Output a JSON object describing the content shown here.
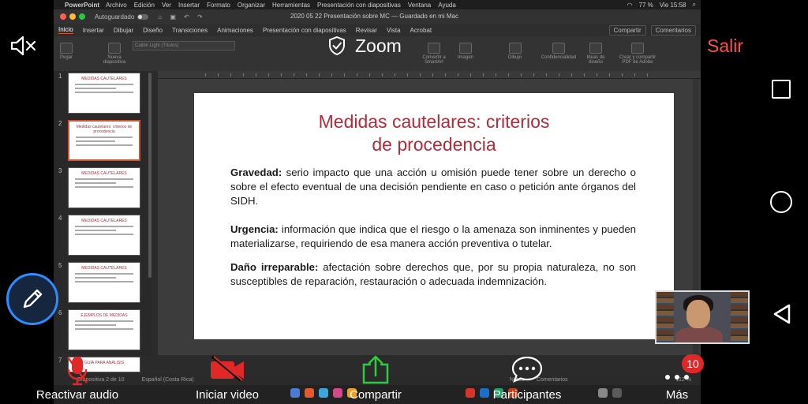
{
  "mac_menu": {
    "app": "PowerPoint",
    "items": [
      "Archivo",
      "Edición",
      "Ver",
      "Insertar",
      "Formato",
      "Organizar",
      "Herramientas",
      "Presentación con diapositivas",
      "Ventana",
      "Ayuda"
    ],
    "battery": "77 %",
    "clock": "Vie 15:58"
  },
  "ppt": {
    "autosave_label": "Autoguardado",
    "doc_title": "2020 05 22 Presentación sobre MC — Guardado en mi Mac",
    "tabs": [
      "Inicio",
      "Insertar",
      "Dibujar",
      "Diseño",
      "Transiciones",
      "Animaciones",
      "Presentación con diapositivas",
      "Revisar",
      "Vista",
      "Acrobat"
    ],
    "share_label": "Compartir",
    "comments_label": "Comentarios",
    "ribbon": {
      "paste": "Pegar",
      "new_slide": "Nueva diapositiva",
      "font": "Calibri Light (Títulos)",
      "smartart": "Convertir a SmartArt",
      "image": "Imagen",
      "draw": "Dibujo",
      "confidentiality": "Confidencialidad",
      "design_ideas": "Ideas de diseño",
      "create_pdf": "Crear y compartir PDF de Adobe"
    },
    "thumbnails": [
      {
        "num": "1",
        "title": "MEDIDAS CAUTELARES"
      },
      {
        "num": "2",
        "title": "Medidas cautelares: criterios de procedencia"
      },
      {
        "num": "3",
        "title": "MEDIDAS CAUTELARES"
      },
      {
        "num": "4",
        "title": "MEDIDAS CAUTELARES"
      },
      {
        "num": "5",
        "title": "MEDIDAS CAUTELARES"
      },
      {
        "num": "6",
        "title": "EJEMPLOS DE MEDIDAS"
      },
      {
        "num": "7",
        "title": "GUÍA PARA ANÁLISIS"
      }
    ],
    "status": {
      "slide_of": "Diapositiva 2 de 10",
      "language": "Español (Costa Rica)",
      "notes": "Notas",
      "comments": "Comentarios",
      "zoom": "112 %"
    }
  },
  "slide": {
    "title_line1": "Medidas cautelares: criterios",
    "title_line2": "de procedencia",
    "paragraphs": [
      {
        "term": "Gravedad:",
        "text": " serio impacto que una acción u omisión puede tener sobre un derecho o sobre el efecto eventual de una decisión pendiente en caso o petición ante órganos del SIDH."
      },
      {
        "term": "Urgencia:",
        "text": " información que indica que el riesgo o la amenaza son inminentes y pueden materializarse, requiriendo de esa manera acción preventiva o tutelar."
      },
      {
        "term": "Daño irreparable:",
        "text": " afectación sobre derechos que, por su propia naturaleza, no son susceptibles de reparación, restauración o adecuada indemnización."
      }
    ]
  },
  "zoom": {
    "title": "Zoom",
    "exit": "Salir",
    "toolbar": {
      "audio": "Reactivar audio",
      "video": "Iniciar video",
      "share": "Compartir",
      "participants": "Participantes",
      "more": "Más"
    },
    "participants_count": "10",
    "icons": {
      "speaker": "speaker-muted-icon",
      "shield": "shield-check-icon",
      "annotate": "pencil-icon"
    },
    "colors": {
      "exit": "#ff4d4d",
      "muted": "#e02828",
      "share": "#2ecc40",
      "accent": "#2d8cff"
    }
  }
}
